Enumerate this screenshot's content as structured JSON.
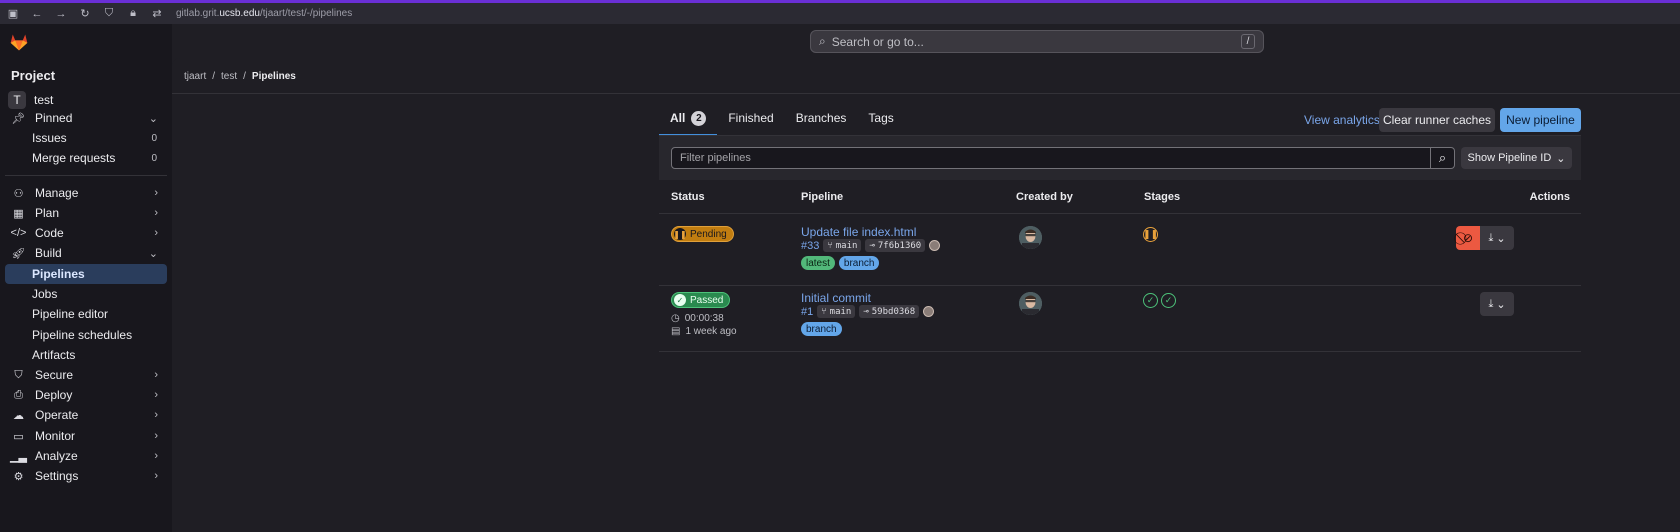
{
  "browser": {
    "url_prefix": "gitlab.grit.",
    "url_domain": "ucsb.edu",
    "url_path": "/tjaart/test/-/pipelines"
  },
  "search": {
    "placeholder": "Search or go to...",
    "shortcut": "/"
  },
  "sidebar": {
    "heading": "Project",
    "project_initial": "T",
    "project_name": "test",
    "pinned": {
      "label": "Pinned",
      "items": [
        {
          "label": "Issues",
          "count": "0"
        },
        {
          "label": "Merge requests",
          "count": "0"
        }
      ]
    },
    "sections": {
      "manage": "Manage",
      "plan": "Plan",
      "code": "Code",
      "build": "Build",
      "secure": "Secure",
      "deploy": "Deploy",
      "operate": "Operate",
      "monitor": "Monitor",
      "analyze": "Analyze",
      "settings": "Settings"
    },
    "build_items": [
      "Pipelines",
      "Jobs",
      "Pipeline editor",
      "Pipeline schedules",
      "Artifacts"
    ]
  },
  "breadcrumb": {
    "user": "tjaart",
    "project": "test",
    "current": "Pipelines"
  },
  "tabs": [
    {
      "label": "All",
      "count": "2"
    },
    {
      "label": "Finished"
    },
    {
      "label": "Branches"
    },
    {
      "label": "Tags"
    }
  ],
  "actions": {
    "analytics": "View analytics",
    "clear_caches": "Clear runner caches",
    "new_pipeline": "New pipeline"
  },
  "filter": {
    "placeholder": "Filter pipelines",
    "sort_label": "Show Pipeline ID"
  },
  "table": {
    "headers": {
      "status": "Status",
      "pipeline": "Pipeline",
      "created_by": "Created by",
      "stages": "Stages",
      "actions": "Actions"
    },
    "rows": [
      {
        "status": "Pending",
        "title": "Update file index.html",
        "id": "#33",
        "branch": "main",
        "commit": "7f6b1360",
        "tags": [
          "latest",
          "branch"
        ]
      },
      {
        "status": "Passed",
        "title": "Initial commit",
        "id": "#1",
        "branch": "main",
        "commit": "59bd0368",
        "duration": "00:00:38",
        "finished": "1 week ago",
        "tags": [
          "branch"
        ]
      }
    ]
  },
  "colors": {
    "accent": "#63a6e9",
    "pending": "#c17d10",
    "passed": "#2a8a4f",
    "cancel": "#ec5941"
  }
}
